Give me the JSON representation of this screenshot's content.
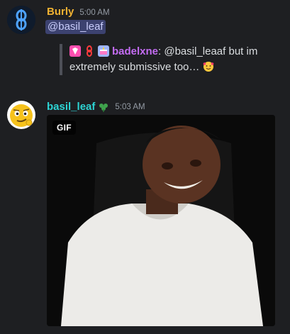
{
  "messages": [
    {
      "author": "Burly",
      "author_color": "#f0b232",
      "timestamp": "5:00 AM",
      "avatar_icon": "blue-link-chain-icon",
      "mention": "@basil_leaf",
      "quote": {
        "author": "badelxne",
        "author_color": "#c36cf2",
        "text": ": @basil_leaaf but im extremely submissive too…",
        "emoji": "smiling-face-with-hearts-icon",
        "badges": [
          "pink-gem-badge-icon",
          "red-chain-badge-icon",
          "cake-badge-icon"
        ]
      }
    },
    {
      "author": "basil_leaf",
      "author_color": "#2dd4d4",
      "timestamp": "5:03 AM",
      "avatar_icon": "winking-face-emoji-avatar",
      "role_icon": "green-clover-icon",
      "attachment": {
        "type": "gif",
        "label": "GIF"
      }
    }
  ]
}
